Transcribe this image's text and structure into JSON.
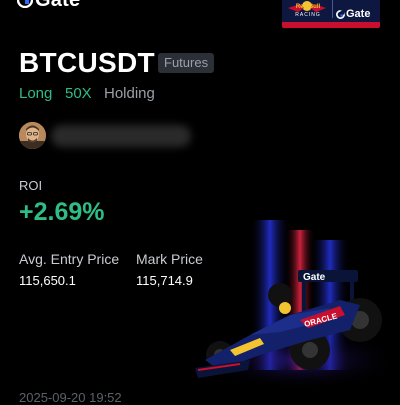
{
  "header": {
    "brand": "Gate",
    "badge": {
      "team_text": "Red Bull",
      "racing_text": "RACING",
      "sponsor": "Gate"
    }
  },
  "position": {
    "symbol": "BTCUSDT",
    "tag": "Futures",
    "side": "Long",
    "leverage": "50X",
    "status": "Holding"
  },
  "roi": {
    "label": "ROI",
    "value": "+2.69%"
  },
  "prices": {
    "entry_label": "Avg. Entry Price",
    "entry_value": "115,650.1",
    "mark_label": "Mark Price",
    "mark_value": "115,714.9"
  },
  "timestamp": "2025-09-20 19:52",
  "colors": {
    "accent_green": "#2ebd85",
    "muted_text": "#9aa0a8",
    "tag_bg": "#2b2f36",
    "badge_bg": "#0d1740",
    "redbull_red": "#c8102e",
    "redbull_yellow": "#f4c430"
  },
  "icons": {
    "logo": "gate-logo-icon",
    "avatar": "user-avatar"
  }
}
